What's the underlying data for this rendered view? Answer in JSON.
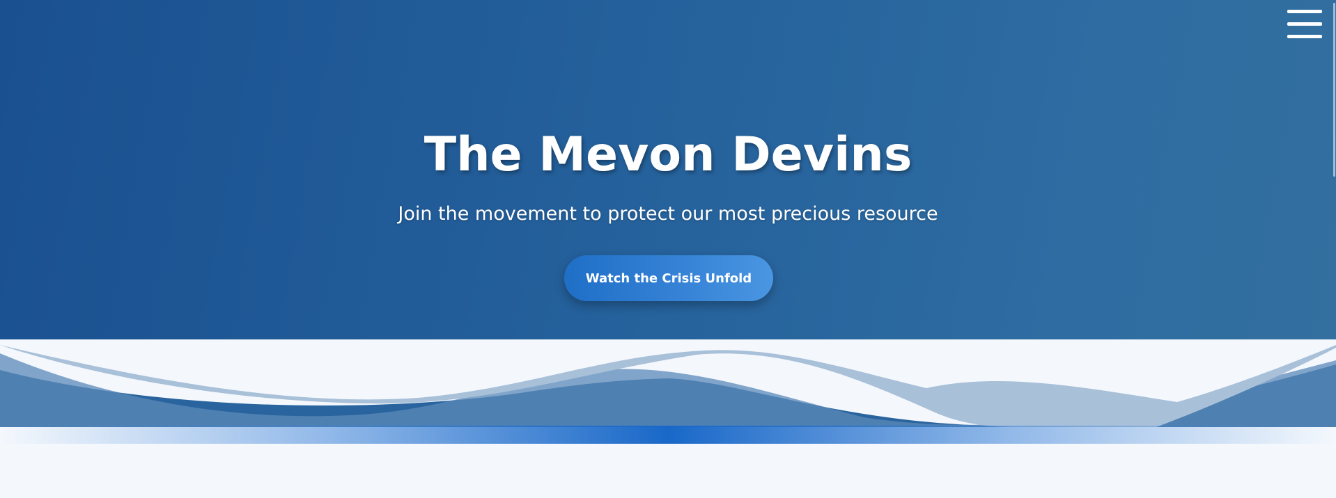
{
  "hero": {
    "title": "The Mevon Devins",
    "subtitle": "Join the movement to protect our most precious resource",
    "cta_label": "Watch the Crisis Unfold"
  },
  "nav": {
    "menu_icon": "hamburger-menu-icon"
  },
  "colors": {
    "hero_start": "#1a5090",
    "hero_end": "#336f9f",
    "accent": "#1968c8",
    "page_background": "#f4f8fd"
  }
}
